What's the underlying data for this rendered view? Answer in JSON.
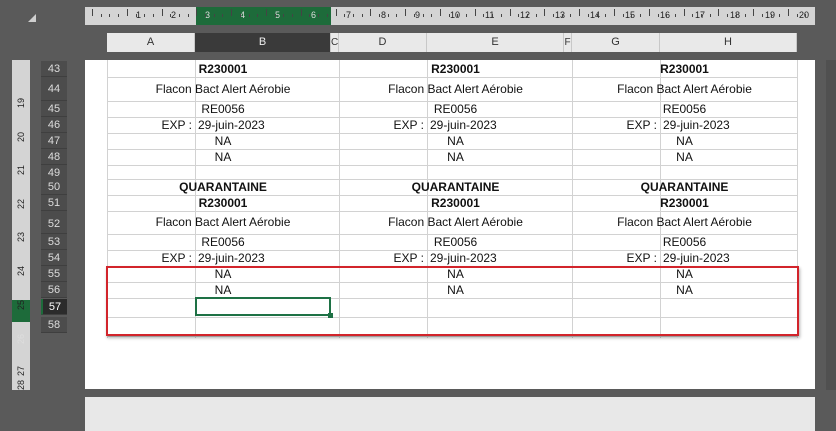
{
  "ruler": {
    "h_numbers": [
      "1",
      "2",
      "3",
      "4",
      "5",
      "6",
      "7",
      "8",
      "9",
      "10",
      "11",
      "12",
      "13",
      "14",
      "15",
      "16",
      "17",
      "18",
      "19",
      "20"
    ],
    "v_numbers": [
      "19",
      "20",
      "21",
      "22",
      "23",
      "24",
      "25",
      "26",
      "27",
      "28"
    ]
  },
  "columns": [
    "A",
    "B",
    "C",
    "D",
    "E",
    "F",
    "G",
    "H"
  ],
  "rows": [
    "43",
    "44",
    "45",
    "46",
    "47",
    "48",
    "49",
    "50",
    "51",
    "52",
    "53",
    "54",
    "55",
    "56",
    "57",
    "58"
  ],
  "block1": {
    "code": "R230001",
    "product": "Flacon Bact Alert Aérobie",
    "ref": "RE0056",
    "exp_label": "EXP :",
    "exp_date": "29-juin-2023",
    "na1": "NA",
    "na2": "NA"
  },
  "block2": {
    "status": "QUARANTAINE",
    "code": "R230001",
    "product": "Flacon Bact Alert Aérobie",
    "ref": "RE0056",
    "exp_label": "EXP :",
    "exp_date": "29-juin-2023",
    "na1": "NA",
    "na2": "NA"
  },
  "colors": {
    "selection": "#1e7145",
    "highlight_box": "#d2242b"
  }
}
